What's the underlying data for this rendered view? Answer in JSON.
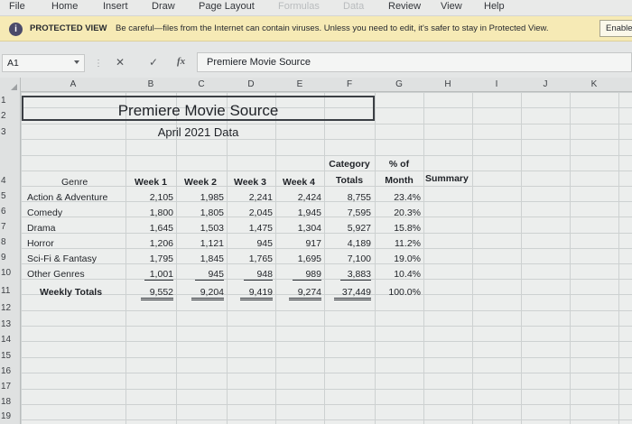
{
  "ribbon": {
    "tabs": [
      "File",
      "Home",
      "Insert",
      "Draw",
      "Page Layout",
      "Formulas",
      "Data",
      "Review",
      "View",
      "Help"
    ]
  },
  "protected": {
    "title": "PROTECTED VIEW",
    "message": "Be careful—files from the Internet can contain viruses. Unless you need to edit, it's safer to stay in Protected View.",
    "button_label": "Enable Editing"
  },
  "formula_bar": {
    "name_box": "A1",
    "cancel_icon": "✕",
    "enter_icon": "✓",
    "fx_label": "fx",
    "content": "Premiere Movie Source"
  },
  "grid": {
    "columns": [
      "A",
      "B",
      "C",
      "D",
      "E",
      "F",
      "G",
      "H",
      "I",
      "J",
      "K"
    ],
    "rows": [
      "1",
      "2",
      "3",
      "4",
      "5",
      "6",
      "7",
      "8",
      "9",
      "10",
      "11",
      "12",
      "13",
      "14",
      "15",
      "16",
      "17",
      "18",
      "19"
    ]
  },
  "sheet": {
    "title": "Premiere Movie Source",
    "subtitle": "April 2021 Data",
    "headers": {
      "genre": "Genre",
      "week1": "Week 1",
      "week2": "Week 2",
      "week3": "Week 3",
      "week4": "Week 4",
      "category_line1": "Category",
      "category_line2": "Totals",
      "pct_line1": "% of",
      "pct_line2": "Month",
      "summary": "Summary"
    },
    "rows": [
      {
        "genre": "Action & Adventure",
        "w1": "2,105",
        "w2": "1,985",
        "w3": "2,241",
        "w4": "2,424",
        "total": "8,755",
        "pct": "23.4%"
      },
      {
        "genre": "Comedy",
        "w1": "1,800",
        "w2": "1,805",
        "w3": "2,045",
        "w4": "1,945",
        "total": "7,595",
        "pct": "20.3%"
      },
      {
        "genre": "Drama",
        "w1": "1,645",
        "w2": "1,503",
        "w3": "1,475",
        "w4": "1,304",
        "total": "5,927",
        "pct": "15.8%"
      },
      {
        "genre": "Horror",
        "w1": "1,206",
        "w2": "1,121",
        "w3": "945",
        "w4": "917",
        "total": "4,189",
        "pct": "11.2%"
      },
      {
        "genre": "Sci-Fi & Fantasy",
        "w1": "1,795",
        "w2": "1,845",
        "w3": "1,765",
        "w4": "1,695",
        "total": "7,100",
        "pct": "19.0%"
      },
      {
        "genre": "Other Genres",
        "w1": "1,001",
        "w2": "945",
        "w3": "948",
        "w4": "989",
        "total": "3,883",
        "pct": "10.4%"
      }
    ],
    "totals": {
      "label": "Weekly Totals",
      "w1": "9,552",
      "w2": "9,204",
      "w3": "9,419",
      "w4": "9,274",
      "total": "37,449",
      "pct": "100.0%"
    }
  }
}
